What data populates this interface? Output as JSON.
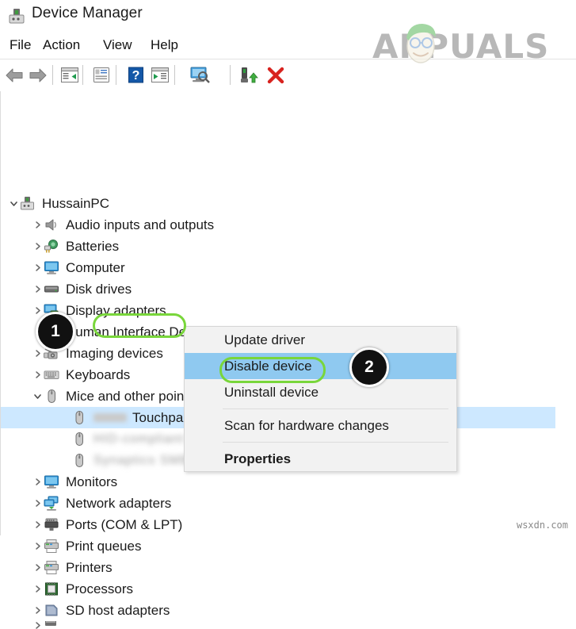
{
  "window": {
    "title": "Device Manager",
    "icon": "device-plug-icon"
  },
  "menubar": {
    "items": [
      {
        "label": "File"
      },
      {
        "label": "Action"
      },
      {
        "label": "View"
      },
      {
        "label": "Help"
      }
    ]
  },
  "toolbar": {
    "buttons": [
      {
        "name": "back-arrow-icon",
        "label": "Back"
      },
      {
        "name": "forward-arrow-icon",
        "label": "Forward"
      },
      {
        "name": "show-hide-console-tree-icon",
        "label": "Show/Hide Console Tree"
      },
      {
        "name": "properties-icon",
        "label": "Properties"
      },
      {
        "name": "help-icon",
        "label": "Help"
      },
      {
        "name": "update-driver-icon",
        "label": "Update Driver Software"
      },
      {
        "name": "scan-hardware-changes-icon",
        "label": "Scan for hardware changes"
      },
      {
        "name": "enable-device-icon",
        "label": "Enable device"
      },
      {
        "name": "uninstall-device-icon",
        "label": "Uninstall device"
      }
    ]
  },
  "tree": {
    "root": {
      "label": "HussainPC",
      "icon": "computer-device-icon",
      "expanded": true
    },
    "items": [
      {
        "label": "Audio inputs and outputs",
        "icon": "speaker-icon",
        "expanded": false
      },
      {
        "label": "Batteries",
        "icon": "battery-icon",
        "expanded": false
      },
      {
        "label": "Computer",
        "icon": "monitor-icon",
        "expanded": false
      },
      {
        "label": "Disk drives",
        "icon": "disk-drive-icon",
        "expanded": false
      },
      {
        "label": "Display adapters",
        "icon": "display-adapter-icon",
        "expanded": false
      },
      {
        "label": "Human Interface Devices",
        "icon": "hid-icon",
        "expanded": false
      },
      {
        "label": "Imaging devices",
        "icon": "imaging-device-icon",
        "expanded": false
      },
      {
        "label": "Keyboards",
        "icon": "keyboard-icon",
        "expanded": false
      },
      {
        "label": "Mice and other pointing devices",
        "icon": "mouse-icon",
        "expanded": true
      }
    ],
    "mice_children": [
      {
        "label": "Touchpad",
        "icon": "mouse-icon",
        "selected": true,
        "blurred_prefix": true
      },
      {
        "label": "",
        "icon": "mouse-icon",
        "selected": false,
        "blurred": true
      },
      {
        "label": "",
        "icon": "mouse-icon",
        "selected": false,
        "blurred": true
      }
    ],
    "items_after": [
      {
        "label": "Monitors",
        "icon": "monitor-icon",
        "expanded": false
      },
      {
        "label": "Network adapters",
        "icon": "network-adapter-icon",
        "expanded": false
      },
      {
        "label": "Ports (COM & LPT)",
        "icon": "port-icon",
        "expanded": false
      },
      {
        "label": "Print queues",
        "icon": "printer-icon",
        "expanded": false
      },
      {
        "label": "Printers",
        "icon": "printer-icon",
        "expanded": false
      },
      {
        "label": "Processors",
        "icon": "processor-icon",
        "expanded": false
      },
      {
        "label": "SD host adapters",
        "icon": "sd-host-adapter-icon",
        "expanded": false
      }
    ]
  },
  "context_menu": {
    "items": [
      {
        "label": "Update driver",
        "highlighted": false,
        "bold": false
      },
      {
        "label": "Disable device",
        "highlighted": true,
        "bold": false
      },
      {
        "label": "Uninstall device",
        "highlighted": false,
        "bold": false
      },
      {
        "label": "Scan for hardware changes",
        "highlighted": false,
        "bold": false
      },
      {
        "label": "Properties",
        "highlighted": false,
        "bold": true
      }
    ]
  },
  "annotations": {
    "badges": [
      {
        "number": "1",
        "target": "Touchpad"
      },
      {
        "number": "2",
        "target": "Disable device"
      }
    ],
    "highlight_color": "#79d63b",
    "selection_color": "#cde8ff",
    "menu_highlight_color": "#8fc9f0"
  },
  "watermarks": {
    "brand": "APPUALS",
    "source": "wsxdn.com"
  }
}
